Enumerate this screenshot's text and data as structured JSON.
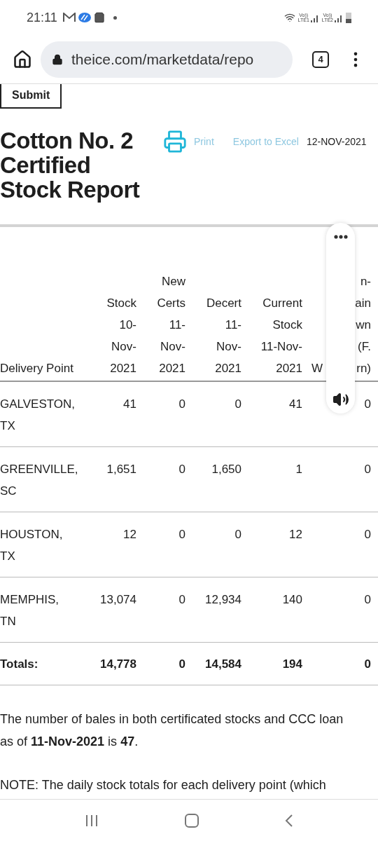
{
  "status_bar": {
    "time": "21:11",
    "sim_labels": [
      "Vo))\nLTE1",
      "Vo))\nLTE2"
    ]
  },
  "browser": {
    "url": "theice.com/marketdata/repo",
    "tab_count": "4"
  },
  "submit_button": "Submit",
  "title": "Cotton No. 2 Certified Stock Report",
  "actions": {
    "print": "Print",
    "export": "Export to Excel",
    "date": "12-NOV-2021"
  },
  "table": {
    "columns": [
      {
        "lines": [
          "Delivery Point"
        ]
      },
      {
        "lines": [
          "Stock",
          "10-",
          "Nov-",
          "2021"
        ]
      },
      {
        "lines": [
          "New",
          "Certs",
          "11-",
          "Nov-",
          "2021"
        ]
      },
      {
        "lines": [
          "Decert",
          "11-",
          "Nov-",
          "2021"
        ]
      },
      {
        "lines": [
          "Current",
          "Stock",
          "11-Nov-",
          "2021"
        ]
      },
      {
        "lines": [
          "n-",
          "ain",
          "wn",
          "(F."
        ],
        "last_line": [
          "W",
          "rn)"
        ]
      }
    ],
    "rows": [
      {
        "cells": [
          "GALVESTON, TX",
          "41",
          "0",
          "0",
          "41",
          "0"
        ]
      },
      {
        "cells": [
          "GREENVILLE, SC",
          "1,651",
          "0",
          "1,650",
          "1",
          "0"
        ]
      },
      {
        "cells": [
          "HOUSTON, TX",
          "12",
          "0",
          "0",
          "12",
          "0"
        ]
      },
      {
        "cells": [
          "MEMPHIS, TN",
          "13,074",
          "0",
          "12,934",
          "140",
          "0"
        ]
      }
    ],
    "totals": [
      "Totals:",
      "14,778",
      "0",
      "14,584",
      "194",
      "0"
    ]
  },
  "paragraph": "The number of bales in both certificated stocks and CCC loan as of **11-Nov-2021** is **47**.",
  "note": "NOTE: The daily stock totals for each delivery point (which"
}
